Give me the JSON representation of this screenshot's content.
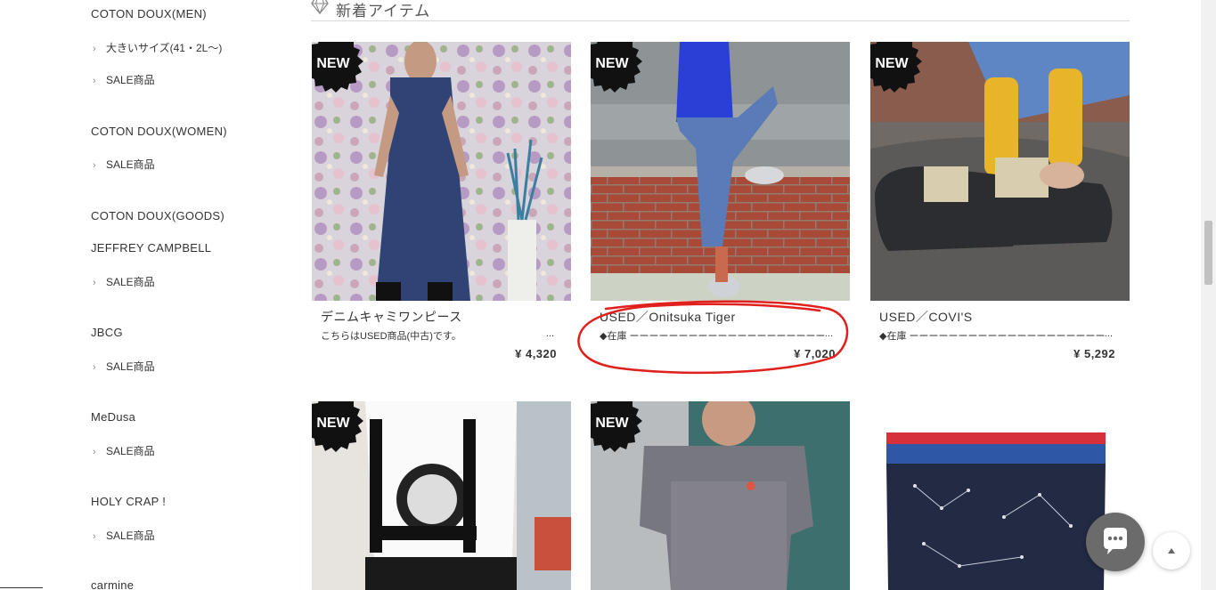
{
  "sidebar": {
    "categories": [
      {
        "label": "COTON DOUX(MEN)"
      },
      {
        "label": "大きいサイズ(41・2L〜)"
      },
      {
        "label": "SALE商品"
      },
      {
        "label": "COTON DOUX(WOMEN)"
      },
      {
        "label": "SALE商品"
      },
      {
        "label": "COTON DOUX(GOODS)"
      },
      {
        "label": "JEFFREY CAMPBELL"
      },
      {
        "label": "SALE商品"
      },
      {
        "label": "JBCG"
      },
      {
        "label": "SALE商品"
      },
      {
        "label": "MeDusa"
      },
      {
        "label": "SALE商品"
      },
      {
        "label": "HOLY CRAP !"
      },
      {
        "label": "SALE商品"
      },
      {
        "label": "carmine"
      }
    ]
  },
  "section": {
    "title": "新着アイテム",
    "icon": "diamond-icon"
  },
  "badge_text": "NEW",
  "products": [
    {
      "name": "デニムキャミワンピース",
      "desc": "こちらはUSED商品(中古)です。",
      "desc_more": "...",
      "price": "¥ 4,320"
    },
    {
      "name": "USED／Onitsuka Tiger",
      "desc": "◆在庫 ーーーーーーーーーーーーーーーーーーーー",
      "desc_more": "...",
      "price": "¥ 7,020"
    },
    {
      "name": "USED／COVI'S",
      "desc": "◆在庫 ーーーーーーーーーーーーーーーーーーーー",
      "desc_more": "...",
      "price": "¥ 5,292"
    }
  ],
  "colors": {
    "annotation": "#e0201c",
    "badge": "#111111",
    "chat_button": "#6b6b6b"
  }
}
